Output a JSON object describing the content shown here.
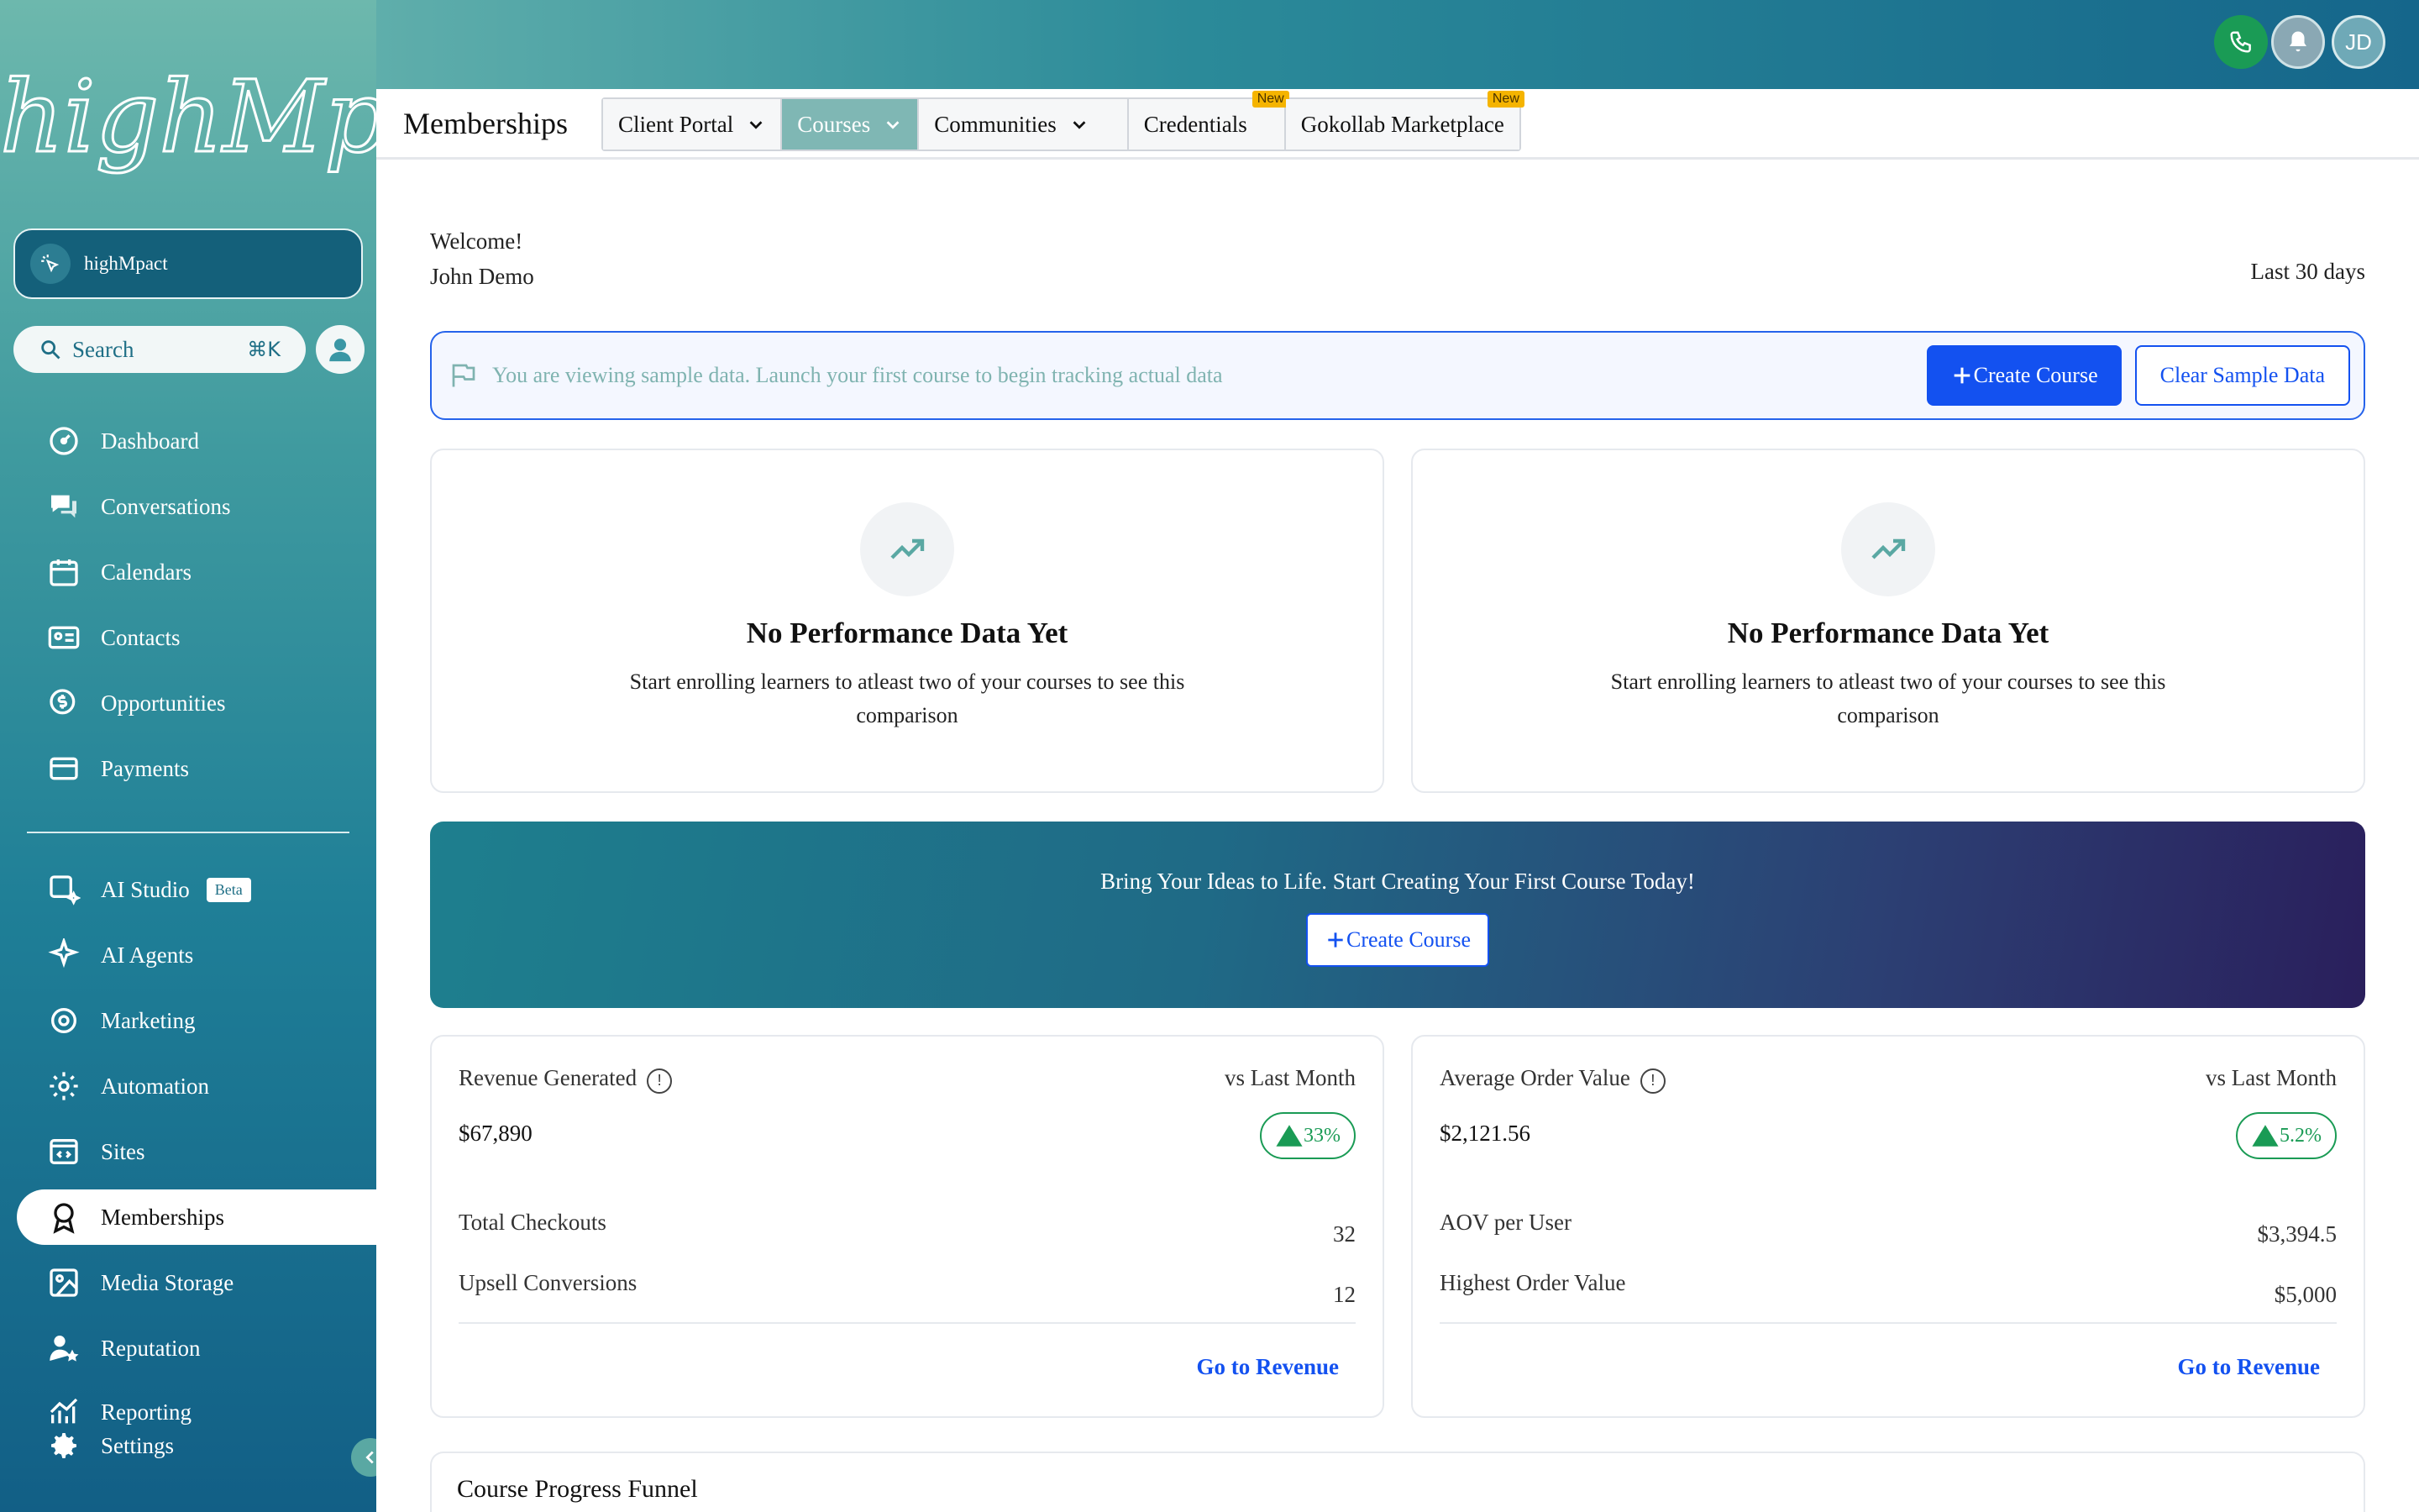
{
  "sidebar": {
    "logo_text": "highMpact",
    "account_name": "highMpact",
    "search_label": "Search",
    "search_shortcut": "⌘K",
    "items": [
      {
        "label": "Dashboard",
        "icon": "dashboard-icon"
      },
      {
        "label": "Conversations",
        "icon": "chat-icon"
      },
      {
        "label": "Calendars",
        "icon": "calendar-icon"
      },
      {
        "label": "Contacts",
        "icon": "contacts-icon"
      },
      {
        "label": "Opportunities",
        "icon": "dollar-icon"
      },
      {
        "label": "Payments",
        "icon": "card-icon"
      },
      {
        "label": "AI Studio",
        "icon": "ai-studio-icon",
        "badge": "Beta"
      },
      {
        "label": "AI Agents",
        "icon": "sparkle-icon"
      },
      {
        "label": "Marketing",
        "icon": "marketing-icon"
      },
      {
        "label": "Automation",
        "icon": "automation-icon"
      },
      {
        "label": "Sites",
        "icon": "sites-icon"
      },
      {
        "label": "Memberships",
        "icon": "award-icon",
        "active": true
      },
      {
        "label": "Media Storage",
        "icon": "image-icon"
      },
      {
        "label": "Reputation",
        "icon": "reputation-icon"
      },
      {
        "label": "Reporting",
        "icon": "chart-icon"
      },
      {
        "label": "Settings",
        "icon": "gear-icon"
      }
    ]
  },
  "header": {
    "avatar_initials": "JD",
    "page_title": "Memberships",
    "tabs": [
      {
        "label": "Client Portal",
        "dropdown": true
      },
      {
        "label": "Courses",
        "dropdown": true,
        "active": true
      },
      {
        "label": "Communities",
        "dropdown": true
      },
      {
        "label": "Credentials",
        "badge": "New"
      },
      {
        "label": "Gokollab Marketplace",
        "badge": "New"
      }
    ]
  },
  "main": {
    "welcome": "Welcome!",
    "user_name": "John Demo",
    "date_range": "Last 30 days",
    "sample_banner": {
      "message": "You are viewing sample data. Launch your first course to begin tracking actual data",
      "create_label": "Create Course",
      "clear_label": "Clear Sample Data"
    },
    "empty_cards": [
      {
        "title": "No Performance Data Yet",
        "text": "Start enrolling learners to atleast two of your courses to see this comparison"
      },
      {
        "title": "No Performance Data Yet",
        "text": "Start enrolling learners to atleast two of your courses to see this comparison"
      }
    ],
    "promo": {
      "text": "Bring Your Ideas to Life. Start Creating Your First Course Today!",
      "button": "Create Course"
    },
    "stats": [
      {
        "title": "Revenue Generated",
        "compare": "vs Last Month",
        "value": "$67,890",
        "change": "33%",
        "rows": [
          {
            "label": "Total Checkouts",
            "value": "32"
          },
          {
            "label": "Upsell Conversions",
            "value": "12"
          }
        ],
        "link": "Go to Revenue"
      },
      {
        "title": "Average Order Value",
        "compare": "vs Last Month",
        "value": "$2,121.56",
        "change": "5.2%",
        "rows": [
          {
            "label": "AOV per User",
            "value": "$3,394.5"
          },
          {
            "label": "Highest Order Value",
            "value": "$5,000"
          }
        ],
        "link": "Go to Revenue"
      }
    ],
    "funnel_title": "Course Progress Funnel"
  },
  "colors": {
    "accent": "#1351f0",
    "positive": "#1a9b55",
    "sidebar_top": "#6db8ad",
    "sidebar_bottom": "#125f86"
  }
}
